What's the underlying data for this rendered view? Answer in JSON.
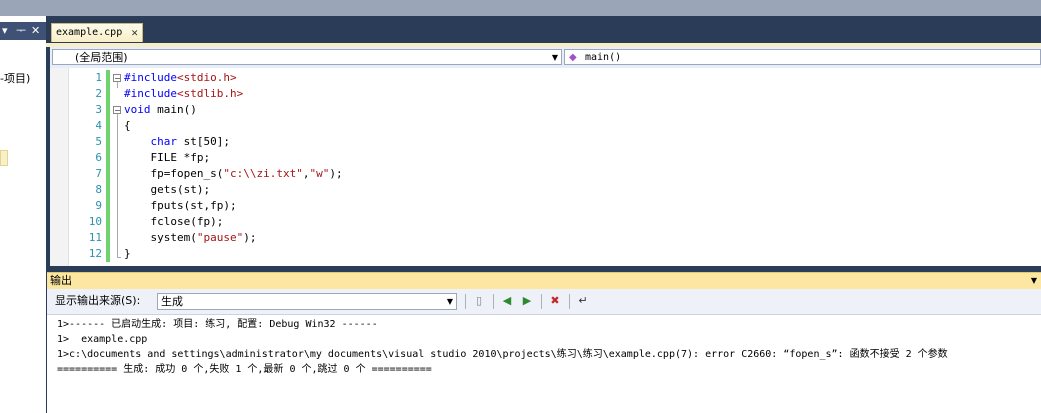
{
  "left_panel": {
    "header_buttons": [
      "▾",
      "ᅮ",
      "✕"
    ],
    "tree_text": "-项目)"
  },
  "editor": {
    "tab_label": "example.cpp",
    "tab_close": "✕",
    "scope": "(全局范围)",
    "member": "main()",
    "line_numbers": [
      "1",
      "2",
      "3",
      "4",
      "5",
      "6",
      "7",
      "8",
      "9",
      "10",
      "11",
      "12"
    ],
    "code": [
      [
        {
          "t": "#include",
          "c": "kw"
        },
        {
          "t": "<stdio.h>",
          "c": "str"
        }
      ],
      [
        {
          "t": "#include",
          "c": "kw"
        },
        {
          "t": "<stdlib.h>",
          "c": "str"
        }
      ],
      [
        {
          "t": "void",
          "c": "kw"
        },
        {
          "t": " main()",
          "c": ""
        }
      ],
      [
        {
          "t": "{",
          "c": ""
        }
      ],
      [
        {
          "t": "    ",
          "c": ""
        },
        {
          "t": "char",
          "c": "kw"
        },
        {
          "t": " st[50];",
          "c": ""
        }
      ],
      [
        {
          "t": "    FILE *fp;",
          "c": ""
        }
      ],
      [
        {
          "t": "    fp=fopen_s(",
          "c": ""
        },
        {
          "t": "\"c:\\\\zi.txt\"",
          "c": "str"
        },
        {
          "t": ",",
          "c": ""
        },
        {
          "t": "\"w\"",
          "c": "str"
        },
        {
          "t": ");",
          "c": ""
        }
      ],
      [
        {
          "t": "    gets(st);",
          "c": ""
        }
      ],
      [
        {
          "t": "    fputs(st,fp);",
          "c": ""
        }
      ],
      [
        {
          "t": "    fclose(fp);",
          "c": ""
        }
      ],
      [
        {
          "t": "    system(",
          "c": ""
        },
        {
          "t": "\"pause\"",
          "c": "str"
        },
        {
          "t": ");",
          "c": ""
        }
      ],
      [
        {
          "t": "}",
          "c": ""
        }
      ]
    ]
  },
  "output": {
    "title": "输出",
    "source_label": "显示输出来源(S):",
    "source_value": "生成",
    "lines": [
      "1>------ 已启动生成: 项目: 练习, 配置: Debug Win32 ------",
      "1>  example.cpp",
      "1>c:\\documents and settings\\administrator\\my documents\\visual studio 2010\\projects\\练习\\练习\\example.cpp(7): error C2660: “fopen_s”: 函数不接受 2 个参数",
      "========== 生成: 成功 0 个,失败 1 个,最新 0 个,跳过 0 个 =========="
    ]
  },
  "colors": {
    "keyword": "#0000ff",
    "string": "#a31515",
    "line_number": "#2b91af",
    "change_bar": "#6fd46f",
    "title_bar": "#2b3c59"
  }
}
